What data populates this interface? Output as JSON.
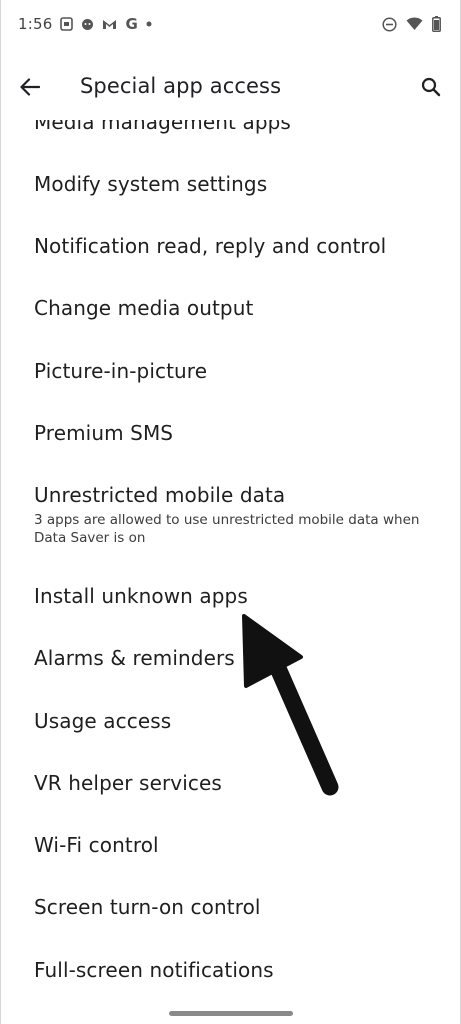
{
  "status_bar": {
    "time": "1:56",
    "left_icons": [
      "screenshot-icon",
      "chat-bubble-icon",
      "gmail-icon",
      "google-g-icon",
      "notification-dot-icon"
    ],
    "right_icons": [
      "do-not-disturb-icon",
      "wifi-icon",
      "battery-icon"
    ]
  },
  "app_bar": {
    "title": "Special app access",
    "back_icon": "arrow-back-icon",
    "search_icon": "search-icon"
  },
  "list": {
    "items": [
      {
        "title": "Media management apps"
      },
      {
        "title": "Modify system settings"
      },
      {
        "title": "Notification read, reply and control"
      },
      {
        "title": "Change media output"
      },
      {
        "title": "Picture-in-picture"
      },
      {
        "title": "Premium SMS"
      },
      {
        "title": "Unrestricted mobile data",
        "summary": "3 apps are allowed to use unrestricted mobile data when Data Saver is on"
      },
      {
        "title": "Install unknown apps"
      },
      {
        "title": "Alarms & reminders"
      },
      {
        "title": "Usage access"
      },
      {
        "title": "VR helper services"
      },
      {
        "title": "Wi-Fi control"
      },
      {
        "title": "Screen turn-on control"
      },
      {
        "title": "Full-screen notifications"
      }
    ]
  },
  "annotation": {
    "icon": "pointer-arrow-icon",
    "color": "#111111",
    "target": "Install unknown apps"
  },
  "colors": {
    "background": "#ffffff",
    "text_primary": "#1f1f1f",
    "text_secondary": "#3c3c3c"
  }
}
